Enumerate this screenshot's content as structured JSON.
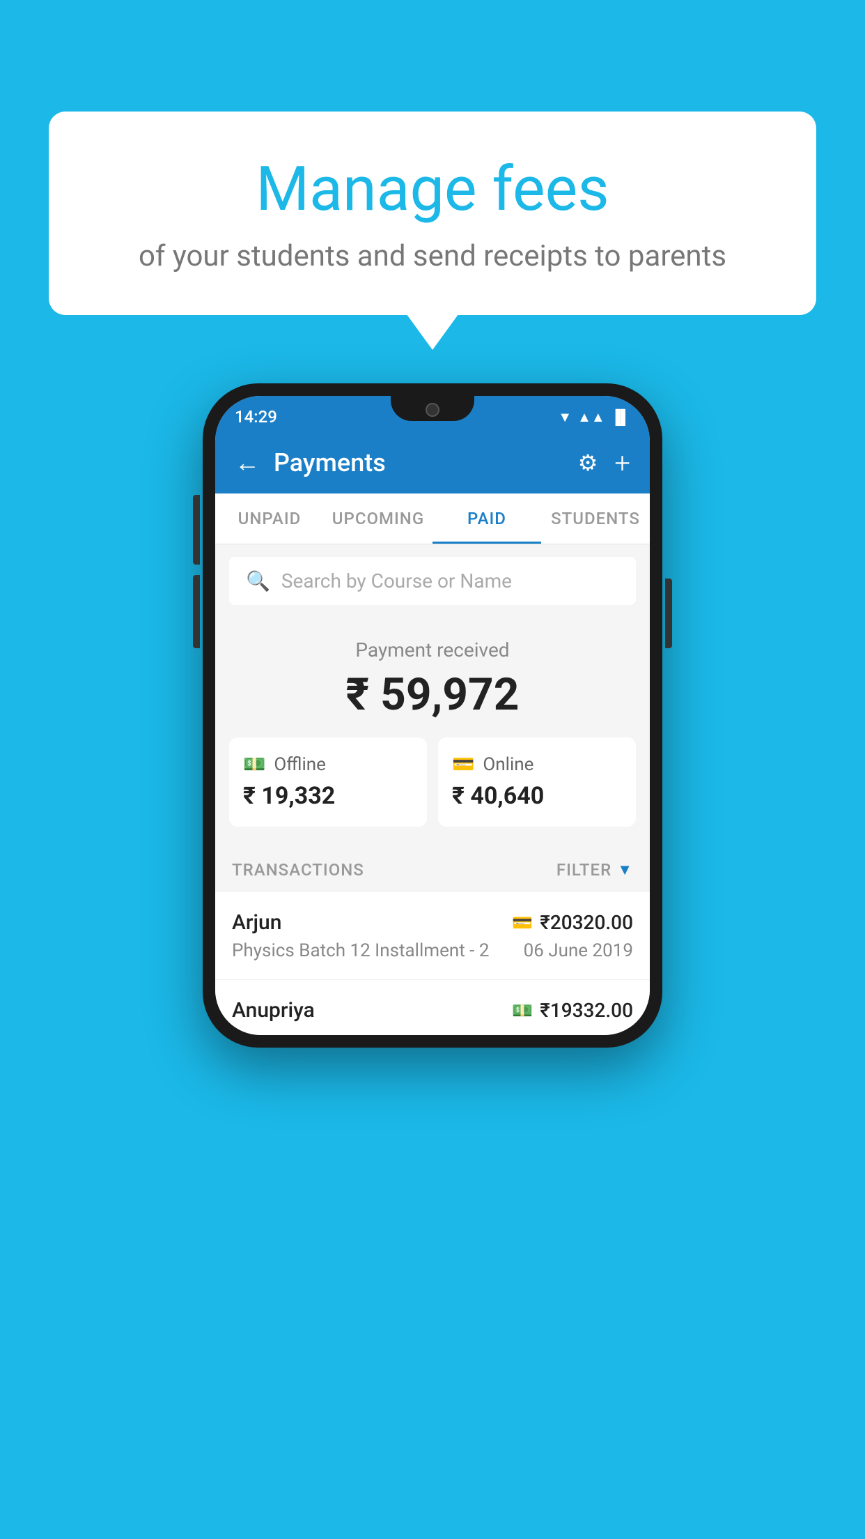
{
  "background_color": "#1BB8E8",
  "speech_bubble": {
    "title": "Manage fees",
    "subtitle": "of your students and send receipts to parents"
  },
  "status_bar": {
    "time": "14:29",
    "wifi": "▲",
    "signal": "▲",
    "battery": "▐"
  },
  "header": {
    "title": "Payments",
    "back_label": "←",
    "settings_label": "⚙",
    "add_label": "+"
  },
  "tabs": [
    {
      "label": "UNPAID",
      "active": false
    },
    {
      "label": "UPCOMING",
      "active": false
    },
    {
      "label": "PAID",
      "active": true
    },
    {
      "label": "STUDENTS",
      "active": false
    }
  ],
  "search": {
    "placeholder": "Search by Course or Name"
  },
  "payment_section": {
    "label": "Payment received",
    "amount": "₹ 59,972",
    "offline": {
      "label": "Offline",
      "amount": "₹ 19,332"
    },
    "online": {
      "label": "Online",
      "amount": "₹ 40,640"
    }
  },
  "transactions": {
    "label": "TRANSACTIONS",
    "filter_label": "FILTER",
    "rows": [
      {
        "name": "Arjun",
        "course": "Physics Batch 12 Installment - 2",
        "amount": "₹20320.00",
        "date": "06 June 2019",
        "payment_type": "card"
      },
      {
        "name": "Anupriya",
        "amount": "₹19332.00",
        "payment_type": "cash"
      }
    ]
  }
}
